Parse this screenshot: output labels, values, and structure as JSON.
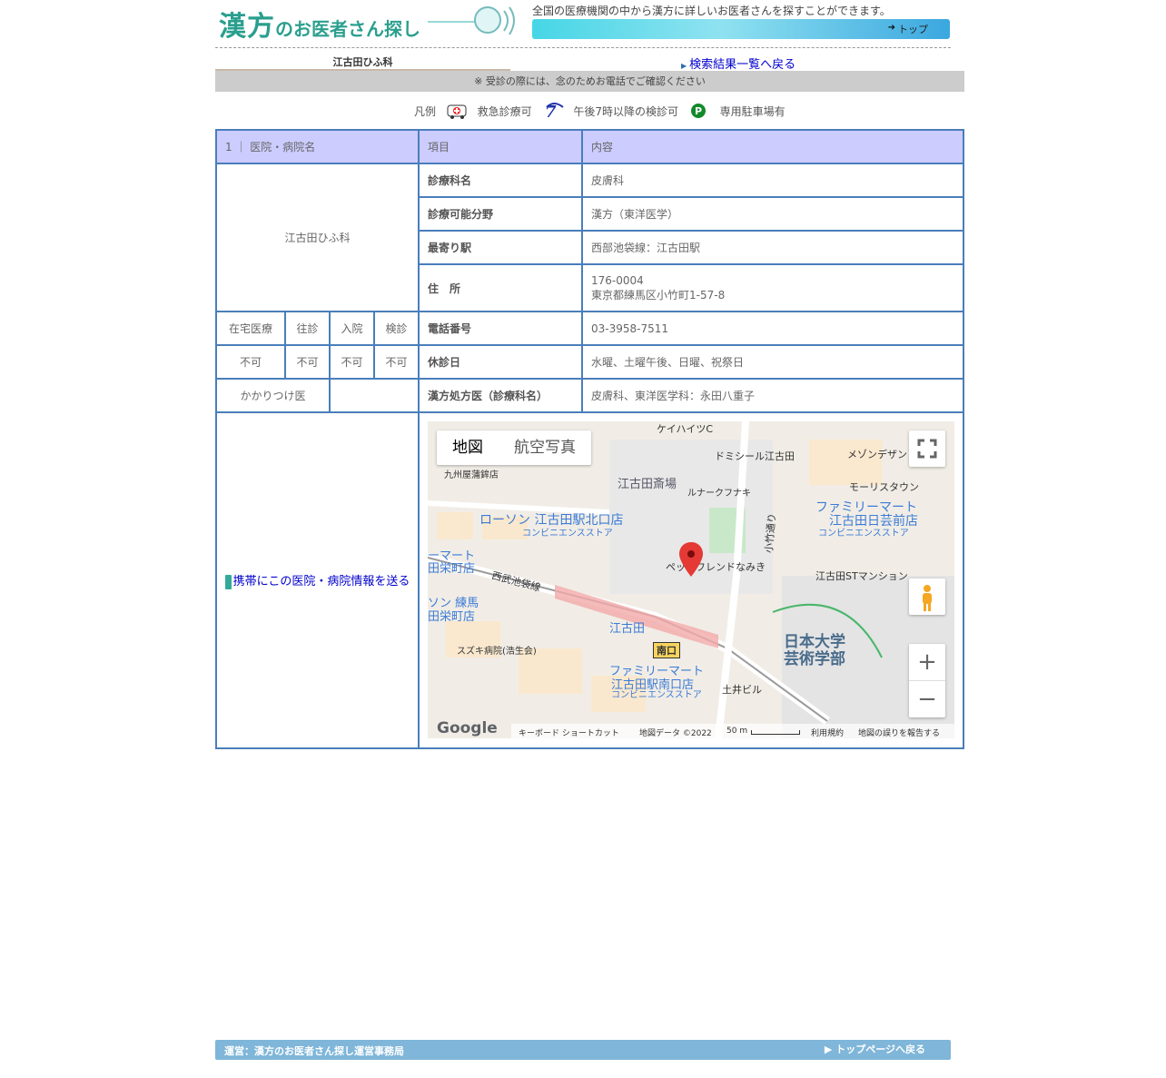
{
  "header": {
    "logo_main": "漢方",
    "logo_sub": "のお医者さん探し",
    "intro": "全国の医療機関の中から漢方に詳しいお医者さんを探すことができます。",
    "top_link": "トップ"
  },
  "clinic_tab": "江古田ひふ科",
  "back_link": "検索結果一覧へ戻る",
  "notice": "※ 受診の際には、念のためお電話でご確認ください",
  "legend": {
    "title": "凡例",
    "items": [
      "救急診療可",
      "午後7時以降の検診可",
      "専用駐車場有"
    ]
  },
  "table": {
    "header_left": "1 ｜ 医院・病院名",
    "header_item": "項目",
    "header_content": "内容",
    "clinic_name": "江古田ひふ科",
    "rows": [
      {
        "label": "診療科名",
        "value": "皮膚科"
      },
      {
        "label": "診療可能分野",
        "value": "漢方（東洋医学）"
      },
      {
        "label": "最寄り駅",
        "value": "西部池袋線：江古田駅"
      },
      {
        "label": "住　所",
        "value_line1": "176-0004",
        "value_line2": "東京都練馬区小竹町1-57-8"
      },
      {
        "label": "電話番号",
        "value": "03-3958-7511"
      },
      {
        "label": "休診日",
        "value": "水曜、土曜午後、日曜、祝祭日"
      },
      {
        "label": "漢方処方医（診療科名）",
        "value": "皮膚科、東洋医学科：永田八重子"
      }
    ],
    "services": {
      "headers": [
        "在宅医療",
        "往診",
        "入院",
        "検診"
      ],
      "values": [
        "不可",
        "不可",
        "不可",
        "不可"
      ]
    },
    "family_doctor": "かかりつけ医",
    "family_doctor_value": "",
    "mobile_link": "携帯にこの医院・病院情報を送る"
  },
  "map": {
    "tab_map": "地図",
    "tab_satellite": "航空写真",
    "labels": {
      "keihaitsu": "ケイハイツC",
      "domicile": "ドミシール江古田",
      "maison": "メゾンデザン",
      "kyushuya": "九州屋蒲鉾店",
      "saijo": "江古田斎場",
      "lunar": "ルナークフナキ",
      "morris": "モーリスタウン",
      "lawson": "ローソン 江古田駅北口店",
      "conv": "コンビニエンスストア",
      "famima1": "ファミリーマート",
      "famima1b": "江古田日芸前店",
      "kotake": "小竹通り",
      "pet": "ペットフレンドなみき",
      "st_mansion": "江古田STマンション",
      "seibu": "西武池袋線",
      "mart": "ーマート",
      "sakaecho": "田栄町店",
      "sakaecho2": "ソン 練馬",
      "sakaecho3": "田栄町店",
      "ekoda": "江古田",
      "minamiguchi": "南口",
      "suzuki": "スズキ病院(浩生会)",
      "famima2": "ファミリーマート",
      "famima2b": "江古田駅南口店",
      "nichidai": "日本大学",
      "nichidai2": "芸術学部",
      "doi": "土井ビル",
      "keyboard": "キーボード ショートカット",
      "mapdata": "地図データ ©2022",
      "scale": "50 m",
      "terms": "利用規約",
      "report": "地図の誤りを報告する",
      "google": "Google"
    }
  },
  "footer": {
    "operator": "運営：漢方のお医者さん探し運営事務局",
    "top_page": "トップページへ戻る"
  }
}
